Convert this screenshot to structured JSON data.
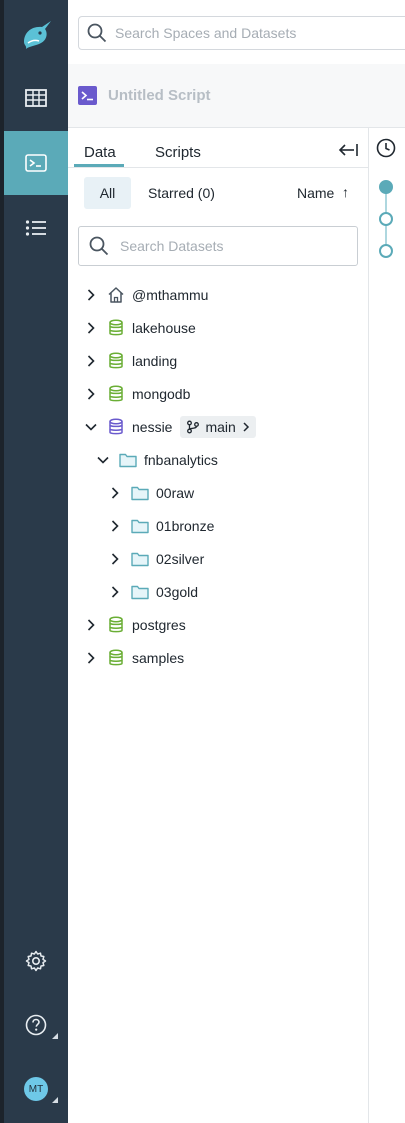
{
  "sidebar": {
    "logo": "narwhal-logo-icon",
    "items": [
      {
        "icon": "datasets-grid-icon"
      },
      {
        "icon": "sql-runner-icon",
        "active": true
      },
      {
        "icon": "jobs-list-icon"
      }
    ],
    "bottom": [
      {
        "icon": "gear-icon"
      },
      {
        "icon": "help-icon"
      }
    ],
    "avatar": "MT"
  },
  "search": {
    "placeholder": "Search Spaces and Datasets"
  },
  "script": {
    "title": "Untitled Script"
  },
  "panel": {
    "tabs": [
      {
        "label": "Data"
      },
      {
        "label": "Scripts"
      }
    ],
    "filters": {
      "all": "All",
      "starred": "Starred (0)"
    },
    "sort": {
      "label": "Name",
      "direction": "↑"
    },
    "search_placeholder": "Search Datasets",
    "tree": [
      {
        "label": "@mthammu",
        "icon": "home-icon",
        "expanded": false
      },
      {
        "label": "lakehouse",
        "icon": "database-icon",
        "expanded": false
      },
      {
        "label": "landing",
        "icon": "database-icon",
        "expanded": false
      },
      {
        "label": "mongodb",
        "icon": "database-icon",
        "expanded": false
      },
      {
        "label": "nessie",
        "icon": "nessie-source-icon",
        "expanded": true,
        "branch": "main"
      },
      {
        "label": "fnbanalytics",
        "icon": "folder-icon",
        "expanded": true
      },
      {
        "label": "00raw",
        "icon": "folder-icon",
        "expanded": false
      },
      {
        "label": "01bronze",
        "icon": "folder-icon",
        "expanded": false
      },
      {
        "label": "02silver",
        "icon": "folder-icon",
        "expanded": false
      },
      {
        "label": "03gold",
        "icon": "folder-icon",
        "expanded": false
      },
      {
        "label": "postgres",
        "icon": "database-icon",
        "expanded": false
      },
      {
        "label": "samples",
        "icon": "database-icon",
        "expanded": false
      }
    ]
  },
  "colors": {
    "accent": "#5baab8",
    "sidebar": "#2a3a4a",
    "database": "#6aae35",
    "folder": "#5baab8",
    "script_icon": "#6a5acd"
  }
}
